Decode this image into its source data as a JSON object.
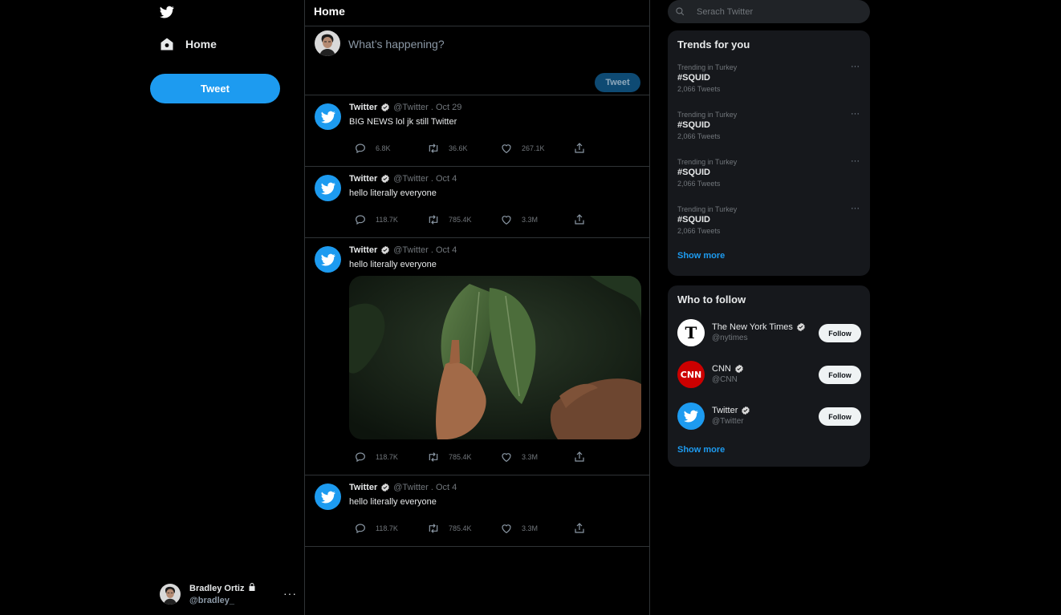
{
  "nav": {
    "home_label": "Home",
    "tweet_button": "Tweet"
  },
  "profile": {
    "name": "Bradley Ortiz",
    "handle": "@bradley_",
    "more": "···"
  },
  "center": {
    "title": "Home",
    "compose_placeholder": "What’s happening?",
    "compose_button": "Tweet"
  },
  "posts": [
    {
      "author": "Twitter",
      "meta": "@Twitter . Oct 29",
      "text": "BIG NEWS lol jk still Twitter",
      "replies": "6.8K",
      "retweets": "36.6K",
      "likes": "267.1K"
    },
    {
      "author": "Twitter",
      "meta": "@Twitter . Oct 4",
      "text": "hello literally everyone",
      "replies": "118.7K",
      "retweets": "785.4K",
      "likes": "3.3M"
    },
    {
      "author": "Twitter",
      "meta": "@Twitter . Oct 4",
      "text": "hello literally everyone",
      "replies": "118.7K",
      "retweets": "785.4K",
      "likes": "3.3M"
    },
    {
      "author": "Twitter",
      "meta": "@Twitter . Oct 4",
      "text": "hello literally everyone",
      "replies": "118.7K",
      "retweets": "785.4K",
      "likes": "3.3M"
    }
  ],
  "search": {
    "placeholder": "Serach Twitter"
  },
  "trends": {
    "title": "Trends for you",
    "items": [
      {
        "context": "Trending in Turkey",
        "tag": "#SQUID",
        "count": "2,066 Tweets"
      },
      {
        "context": "Trending in Turkey",
        "tag": "#SQUID",
        "count": "2,066 Tweets"
      },
      {
        "context": "Trending in Turkey",
        "tag": "#SQUID",
        "count": "2,066 Tweets"
      },
      {
        "context": "Trending in Turkey",
        "tag": "#SQUID",
        "count": "2,066 Tweets"
      }
    ],
    "show_more": "Show more",
    "more": "···"
  },
  "who": {
    "title": "Who to follow",
    "items": [
      {
        "name": "The New York Times",
        "handle": "@nytimes",
        "button": "Follow"
      },
      {
        "name": "CNN",
        "handle": "@CNN",
        "button": "Follow"
      },
      {
        "name": "Twitter",
        "handle": "@Twitter",
        "button": "Follow"
      }
    ],
    "show_more": "Show more"
  },
  "colors": {
    "accent": "#1d9bf0",
    "background": "#000000",
    "card": "#16181c",
    "border": "#2f3336"
  }
}
